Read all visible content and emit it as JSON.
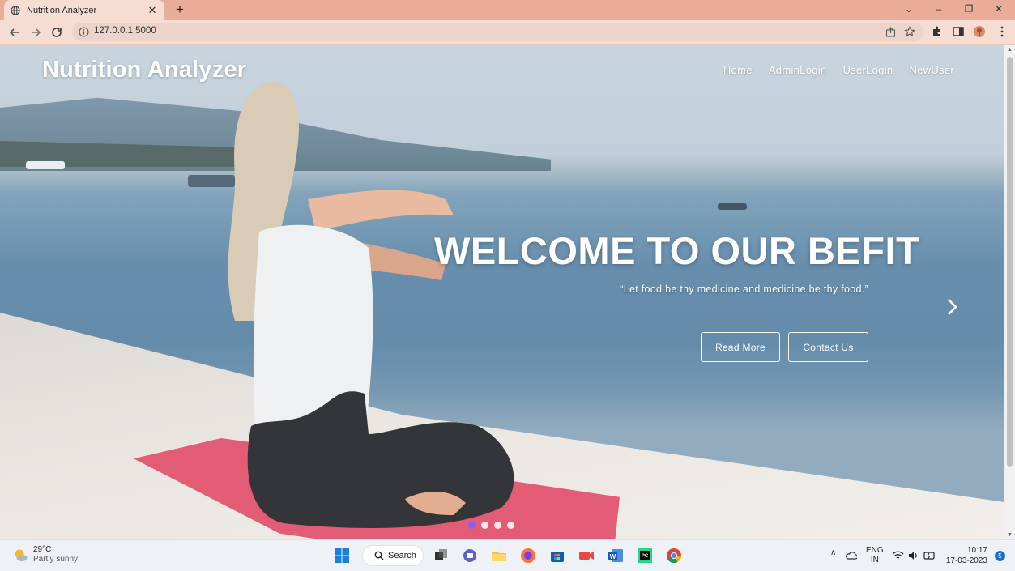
{
  "browser": {
    "tab_title": "Nutrition Analyzer",
    "url": "127.0.0.1:5000"
  },
  "page": {
    "brand": "Nutrition Analyzer",
    "nav": [
      "Home",
      "AdminLogin",
      "UserLogin",
      "NewUser"
    ],
    "hero_title": "WELCOME TO OUR BEFIT",
    "hero_quote": "“Let food be thy medicine and medicine be thy food.”",
    "buttons": {
      "read_more": "Read More",
      "contact_us": "Contact Us"
    },
    "carousel_dots": 4,
    "carousel_active": 1
  },
  "taskbar": {
    "weather_temp": "29°C",
    "weather_condition": "Partly sunny",
    "search_label": "Search",
    "lang_line1": "ENG",
    "lang_line2": "IN",
    "time": "10:17",
    "date": "17-03-2023",
    "notification_count": "5"
  },
  "colors": {
    "tab_strip": "#e9ac98",
    "toolbar": "#f6ddd4",
    "carousel_active_dot": "#8b5cf6",
    "mat": "#e0546d"
  }
}
